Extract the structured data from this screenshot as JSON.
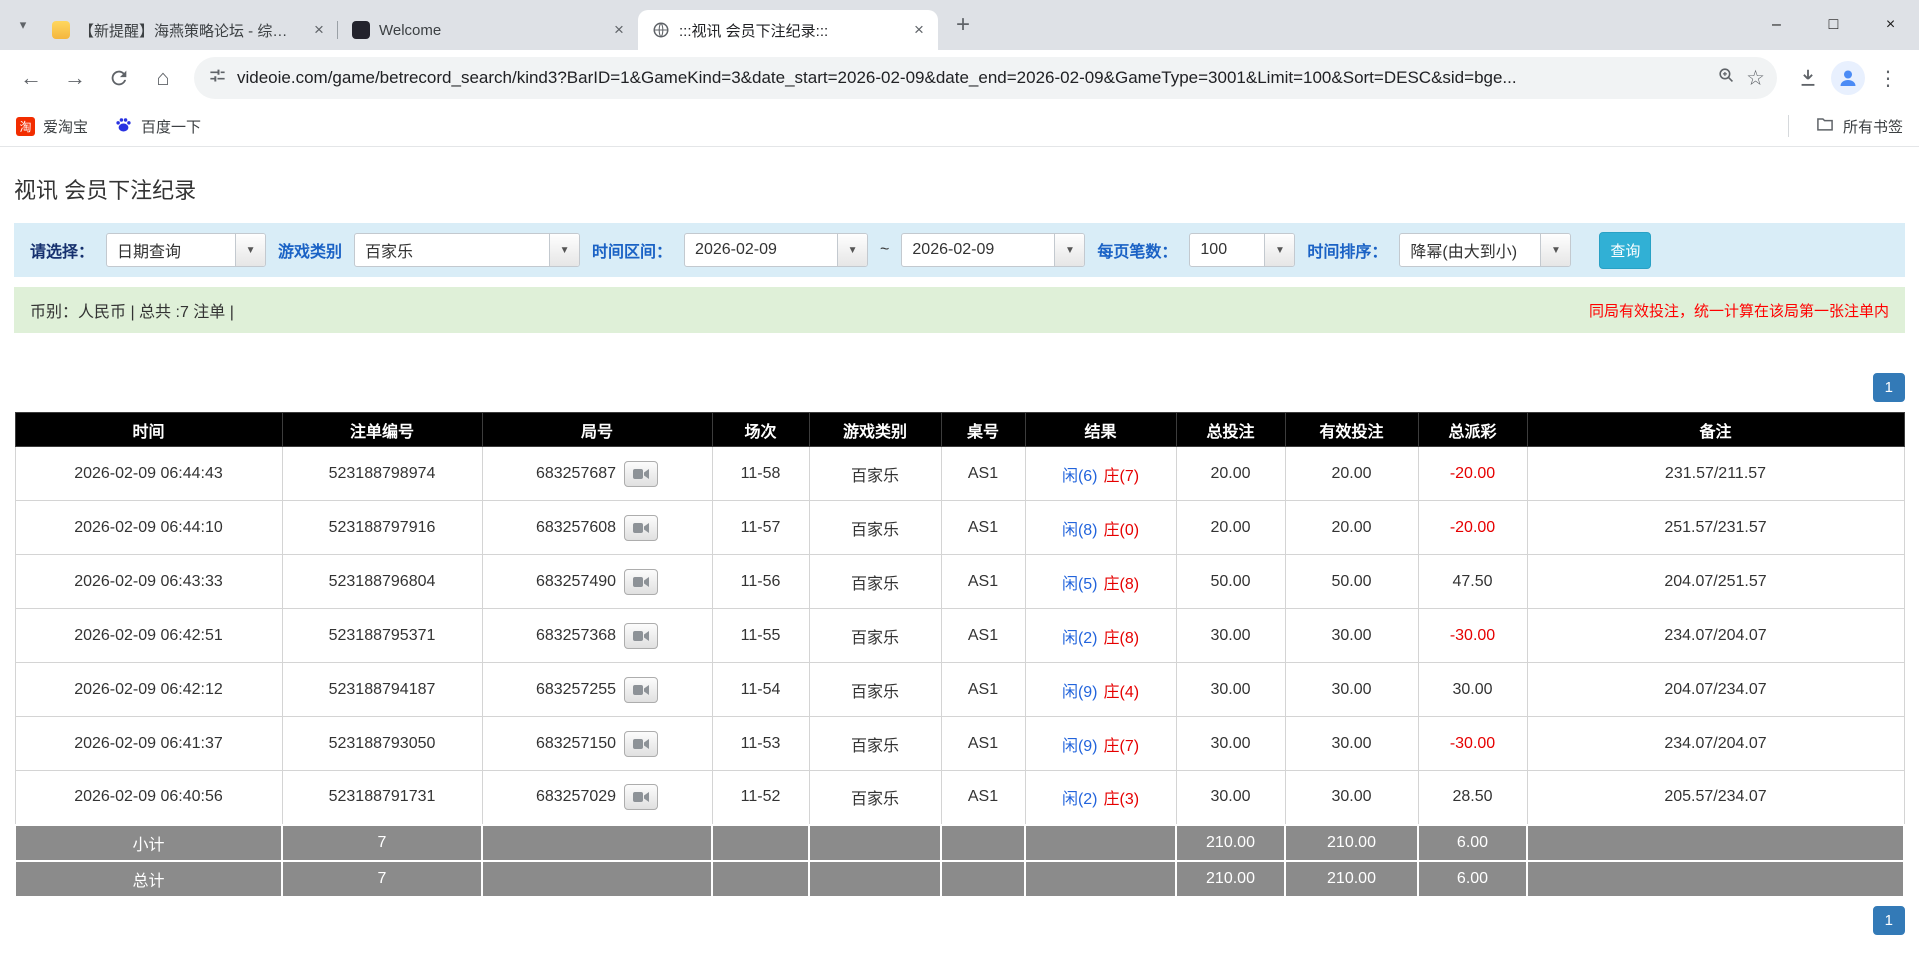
{
  "icons": {
    "tab_search": "▾",
    "close": "×",
    "new_tab": "+",
    "minimize": "–",
    "maximize": "□",
    "back": "←",
    "forward": "→",
    "home": "⌂",
    "star": "☆",
    "menu": "⋮",
    "combo_caret": "▼",
    "taobao_glyph": "淘"
  },
  "colors": {
    "accent_blue": "#337ab7",
    "query_button": "#31b0d5",
    "filter_bg": "#d9edf7",
    "summary_bg": "#dff0d8",
    "table_header_bg": "#000000",
    "table_footer_bg": "#8b8b8b",
    "negative_red": "#e60000",
    "player_blue": "#2264dc",
    "note_red": "#ff0000"
  },
  "browser": {
    "tabs": [
      {
        "title": "【新提醒】海燕策略论坛 - 综合..."
      },
      {
        "title": "Welcome"
      },
      {
        "title": ":::视讯 会员下注纪录:::"
      }
    ],
    "nav": {
      "url": "videoie.com/game/betrecord_search/kind3?BarID=1&GameKind=3&date_start=2026-02-09&date_end=2026-02-09&GameType=3001&Limit=100&Sort=DESC&sid=bge..."
    },
    "bookmarks": {
      "items": [
        {
          "label": "爱淘宝"
        },
        {
          "label": "百度一下"
        }
      ],
      "all_bookmarks": "所有书签"
    }
  },
  "page": {
    "title": "视讯 会员下注纪录",
    "filters": {
      "select_label": "请选择：",
      "select_value": "日期查询",
      "game_label": "游戏类别",
      "game_value": "百家乐",
      "range_label": "时间区间：",
      "date_start": "2026-02-09",
      "tilde": "~",
      "date_end": "2026-02-09",
      "per_page_label": "每页笔数：",
      "per_page_value": "100",
      "sort_label": "时间排序：",
      "sort_value": "降幂(由大到小)",
      "query_button": "查询"
    },
    "summary": {
      "currency_info": "币别：人民币 | 总共 :7 注单 |",
      "note": "同局有效投注，统一计算在该局第一张注单内"
    },
    "pagination": "1",
    "table": {
      "headers": [
        "时间",
        "注单编号",
        "局号",
        "场次",
        "游戏类别",
        "桌号",
        "结果",
        "总投注",
        "有效投注",
        "总派彩",
        "备注"
      ],
      "rows": [
        {
          "time": "2026-02-09 06:44:43",
          "bet_id": "523188798974",
          "round_id": "683257687",
          "session": "11-58",
          "game": "百家乐",
          "table_no": "AS1",
          "result_player": "闲(6)",
          "result_banker": "庄(7)",
          "total_bet": "20.00",
          "valid_bet": "20.00",
          "payout": "-20.00",
          "note": "231.57/211.57"
        },
        {
          "time": "2026-02-09 06:44:10",
          "bet_id": "523188797916",
          "round_id": "683257608",
          "session": "11-57",
          "game": "百家乐",
          "table_no": "AS1",
          "result_player": "闲(8)",
          "result_banker": "庄(0)",
          "total_bet": "20.00",
          "valid_bet": "20.00",
          "payout": "-20.00",
          "note": "251.57/231.57"
        },
        {
          "time": "2026-02-09 06:43:33",
          "bet_id": "523188796804",
          "round_id": "683257490",
          "session": "11-56",
          "game": "百家乐",
          "table_no": "AS1",
          "result_player": "闲(5)",
          "result_banker": "庄(8)",
          "total_bet": "50.00",
          "valid_bet": "50.00",
          "payout": "47.50",
          "note": "204.07/251.57"
        },
        {
          "time": "2026-02-09 06:42:51",
          "bet_id": "523188795371",
          "round_id": "683257368",
          "session": "11-55",
          "game": "百家乐",
          "table_no": "AS1",
          "result_player": "闲(2)",
          "result_banker": "庄(8)",
          "total_bet": "30.00",
          "valid_bet": "30.00",
          "payout": "-30.00",
          "note": "234.07/204.07"
        },
        {
          "time": "2026-02-09 06:42:12",
          "bet_id": "523188794187",
          "round_id": "683257255",
          "session": "11-54",
          "game": "百家乐",
          "table_no": "AS1",
          "result_player": "闲(9)",
          "result_banker": "庄(4)",
          "total_bet": "30.00",
          "valid_bet": "30.00",
          "payout": "30.00",
          "note": "204.07/234.07"
        },
        {
          "time": "2026-02-09 06:41:37",
          "bet_id": "523188793050",
          "round_id": "683257150",
          "session": "11-53",
          "game": "百家乐",
          "table_no": "AS1",
          "result_player": "闲(9)",
          "result_banker": "庄(7)",
          "total_bet": "30.00",
          "valid_bet": "30.00",
          "payout": "-30.00",
          "note": "234.07/204.07"
        },
        {
          "time": "2026-02-09 06:40:56",
          "bet_id": "523188791731",
          "round_id": "683257029",
          "session": "11-52",
          "game": "百家乐",
          "table_no": "AS1",
          "result_player": "闲(2)",
          "result_banker": "庄(3)",
          "total_bet": "30.00",
          "valid_bet": "30.00",
          "payout": "28.50",
          "note": "205.57/234.07"
        }
      ],
      "footer": [
        {
          "label": "小计",
          "count": "7",
          "total_bet": "210.00",
          "valid_bet": "210.00",
          "payout": "6.00"
        },
        {
          "label": "总计",
          "count": "7",
          "total_bet": "210.00",
          "valid_bet": "210.00",
          "payout": "6.00"
        }
      ]
    }
  }
}
